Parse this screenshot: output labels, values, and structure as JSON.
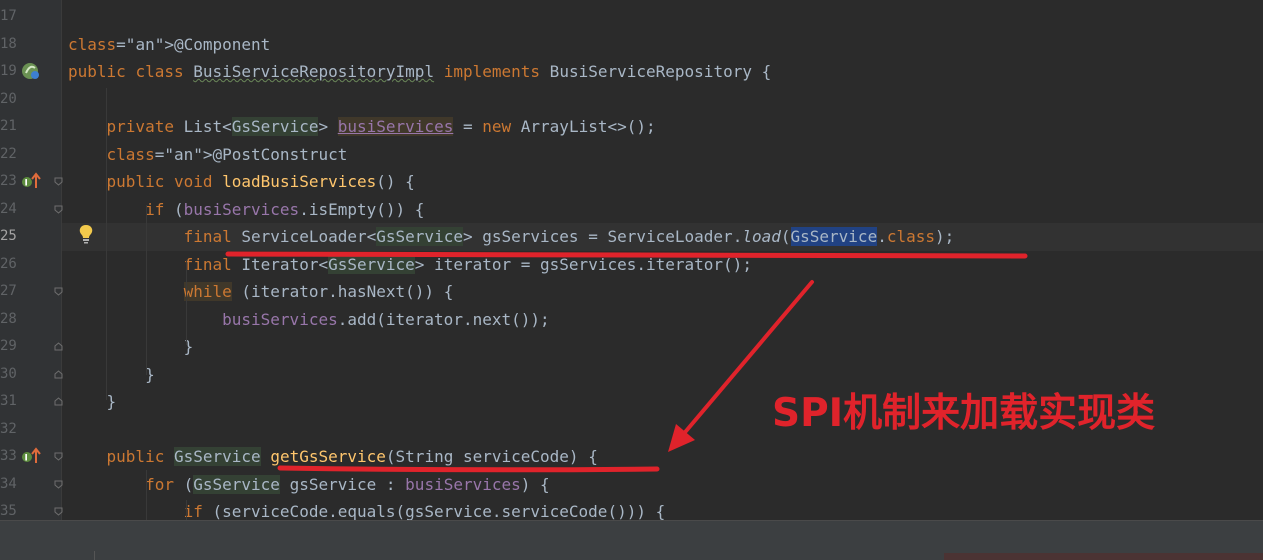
{
  "editor": {
    "lines": [
      {
        "num": "17"
      },
      {
        "num": "18",
        "text": "@Component"
      },
      {
        "num": "19",
        "text": "public class BusiServiceRepositoryImpl implements BusiServiceRepository {"
      },
      {
        "num": "20"
      },
      {
        "num": "21",
        "text": "    private List<GsService> busiServices = new ArrayList<>();"
      },
      {
        "num": "22",
        "text": "    @PostConstruct"
      },
      {
        "num": "23",
        "text": "    public void loadBusiServices() {"
      },
      {
        "num": "24",
        "text": "        if (busiServices.isEmpty()) {"
      },
      {
        "num": "25",
        "text": "            final ServiceLoader<GsService> gsServices = ServiceLoader.load(GsService.class);"
      },
      {
        "num": "26",
        "text": "            final Iterator<GsService> iterator = gsServices.iterator();"
      },
      {
        "num": "27",
        "text": "            while (iterator.hasNext()) {"
      },
      {
        "num": "28",
        "text": "                busiServices.add(iterator.next());"
      },
      {
        "num": "29",
        "text": "            }"
      },
      {
        "num": "30",
        "text": "        }"
      },
      {
        "num": "31",
        "text": "    }"
      },
      {
        "num": "32"
      },
      {
        "num": "33",
        "text": "    public GsService getGsService(String serviceCode) {"
      },
      {
        "num": "34",
        "text": "        for (GsService gsService : busiServices) {"
      },
      {
        "num": "35",
        "text": "            if (serviceCode.equals(gsService.serviceCode())) {"
      }
    ]
  },
  "annotation": {
    "text": "SPI机制来加载实现类",
    "color": "#e0232b"
  },
  "icons": {
    "line19": "spring-bean-icon",
    "line23": "implementation-marker-icon",
    "line25": "lightbulb-icon",
    "line33": "implementation-marker-icon"
  }
}
